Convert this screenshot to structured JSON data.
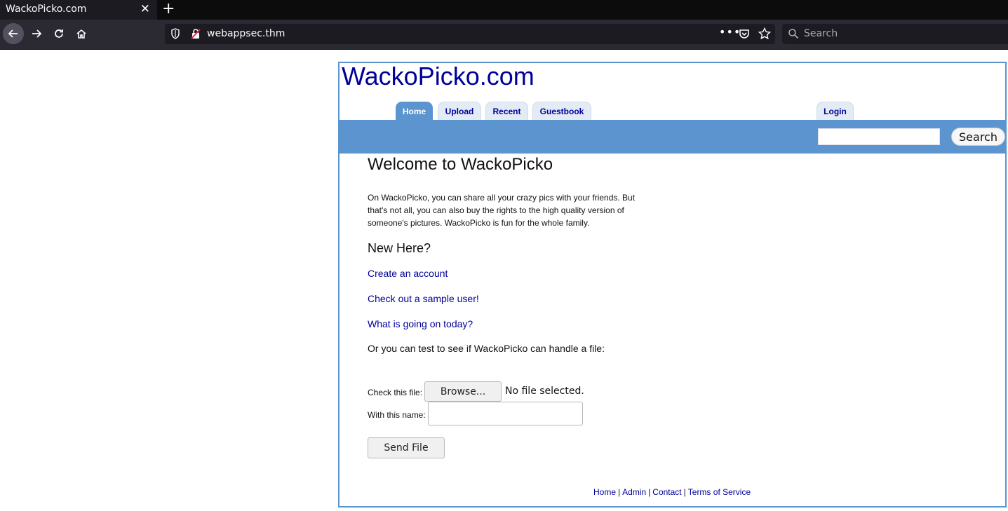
{
  "browser": {
    "tab_title": "WackoPicko.com",
    "url": "webappsec.thm",
    "search_placeholder": "Search"
  },
  "site": {
    "logo": "WackoPicko.com",
    "tabs": [
      {
        "label": "Home",
        "active": true
      },
      {
        "label": "Upload",
        "active": false
      },
      {
        "label": "Recent",
        "active": false
      },
      {
        "label": "Guestbook",
        "active": false
      },
      {
        "label": "Login",
        "active": false
      }
    ],
    "search_button": "Search",
    "accent_color": "#5b94cf",
    "link_color": "#000099"
  },
  "main": {
    "heading": "Welcome to WackoPicko",
    "intro": "On WackoPicko, you can share all your crazy pics with your friends. But that's not all, you can also buy the rights to the high quality version of someone's pictures. WackoPicko is fun for the whole family.",
    "new_here": "New Here?",
    "links": [
      "Create an account",
      "Check out a sample user!",
      "What is going on today?"
    ],
    "test_file_text": "Or you can test to see if WackoPicko can handle a file:",
    "check_label": "Check this file:",
    "browse_label": "Browse...",
    "no_file": "No file selected.",
    "name_label": "With this name:",
    "send_button": "Send File"
  },
  "footer": {
    "links": [
      "Home",
      "Admin",
      "Contact",
      "Terms of Service"
    ],
    "separator": "|"
  }
}
